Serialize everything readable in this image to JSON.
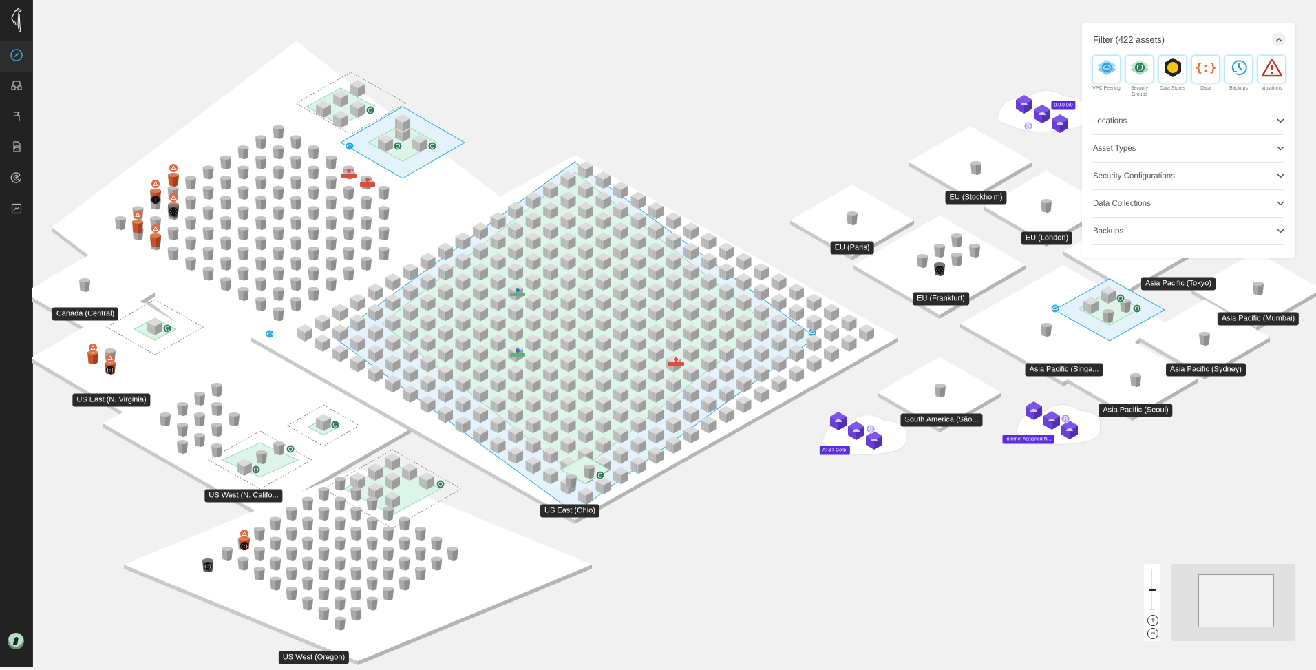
{
  "sidebar": {
    "logo": "bird-logo-icon",
    "items": [
      {
        "name": "explore",
        "icon": "compass-icon",
        "active": true
      },
      {
        "name": "inventory",
        "icon": "binoculars-icon",
        "active": false
      },
      {
        "name": "flags",
        "icon": "flag-icon",
        "active": false
      },
      {
        "name": "data",
        "icon": "database-doc-icon",
        "active": false
      },
      {
        "name": "targets",
        "icon": "radar-icon",
        "active": false
      },
      {
        "name": "reports",
        "icon": "chart-icon",
        "active": false
      }
    ],
    "avatar": "user-avatar"
  },
  "filter": {
    "title": "Filter (422 assets)",
    "collapse_icon": "chevron-up-icon",
    "icons": [
      {
        "label": "VPC Peering",
        "icon": "vpc-peering-icon"
      },
      {
        "label": "Security Groups",
        "icon": "security-group-icon"
      },
      {
        "label": "Data Stores",
        "icon": "data-store-icon"
      },
      {
        "label": "Data",
        "icon": "data-braces-icon"
      },
      {
        "label": "Backups",
        "icon": "backup-clock-icon"
      },
      {
        "label": "Violations",
        "icon": "warning-triangle-icon"
      }
    ],
    "sections": [
      {
        "label": "Locations"
      },
      {
        "label": "Asset Types"
      },
      {
        "label": "Security Configurations"
      },
      {
        "label": "Data Collections"
      },
      {
        "label": "Backups"
      }
    ]
  },
  "regions": [
    {
      "label": "Canada (Central)",
      "buckets": 1
    },
    {
      "label": "US East (N. Virginia)",
      "buckets": 3,
      "violations": 2
    },
    {
      "label": "US West (N. Califo...",
      "buckets": 12
    },
    {
      "label": "US West (Oregon)",
      "buckets": 55,
      "violations": 1
    },
    {
      "label": "US East (Ohio)",
      "instances": 210
    },
    {
      "label": "EU (Stockholm)",
      "buckets": 1
    },
    {
      "label": "EU (Paris)",
      "buckets": 1
    },
    {
      "label": "EU (London)",
      "buckets": 1
    },
    {
      "label": "EU (Frankfurt)",
      "buckets": 6
    },
    {
      "label": "Asia Pacific (Tokyo)"
    },
    {
      "label": "Asia Pacific (Mumbai)",
      "buckets": 1
    },
    {
      "label": "Asia Pacific (Singa...",
      "buckets": 1
    },
    {
      "label": "Asia Pacific (Sydney)",
      "buckets": 1
    },
    {
      "label": "Asia Pacific (Seoul)",
      "buckets": 1
    },
    {
      "label": "South America (São...",
      "buckets": 1
    }
  ],
  "clouds": [
    {
      "tag": "0.0.0.0/0"
    },
    {
      "tag": "AT&T Corp."
    },
    {
      "tag": "Internet Assigned N..."
    }
  ],
  "zoom": {
    "level": 0.75,
    "plus_label": "+",
    "minus_label": "−"
  },
  "colors": {
    "accent": "#29a9e1",
    "violation": "#e8643c",
    "security": "#2f7d5a",
    "internet": "#5b2bde",
    "vpc_fill": "#e4f2fb",
    "subnet_fill": "#dcf5e8"
  }
}
